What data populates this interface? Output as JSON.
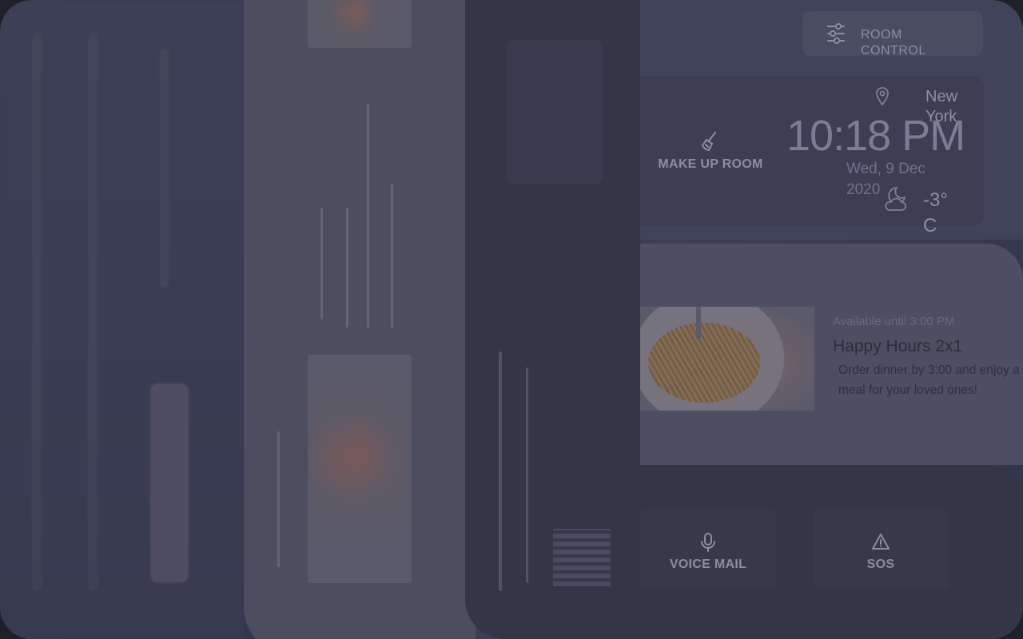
{
  "room_control": {
    "label": "ROOM CONTROL",
    "icon": "sliders-icon"
  },
  "make_up_room": {
    "label": "MAKE UP ROOM",
    "icon": "broom-icon"
  },
  "location": {
    "city": "New York",
    "icon": "location-pin-icon"
  },
  "clock": {
    "time": "10:18 PM",
    "date": "Wed, 9 Dec 2020"
  },
  "weather": {
    "temperature": "-3° C",
    "icon": "cloudy-night-icon"
  },
  "promo": {
    "availability": "Available until 3:00 PM",
    "title": "Happy Hours 2x1",
    "description": "Order dinner by 3:00 and enjoy a meal for your loved ones!"
  },
  "bottom_actions": [
    {
      "label": "VOICE MAIL",
      "icon": "microphone-icon"
    },
    {
      "label": "SOS",
      "icon": "warning-icon"
    }
  ],
  "colors": {
    "background": "#33354a",
    "card": "#4e4e62",
    "text_muted": "#8b8da3",
    "accent_dark": "#2c2d3c"
  }
}
